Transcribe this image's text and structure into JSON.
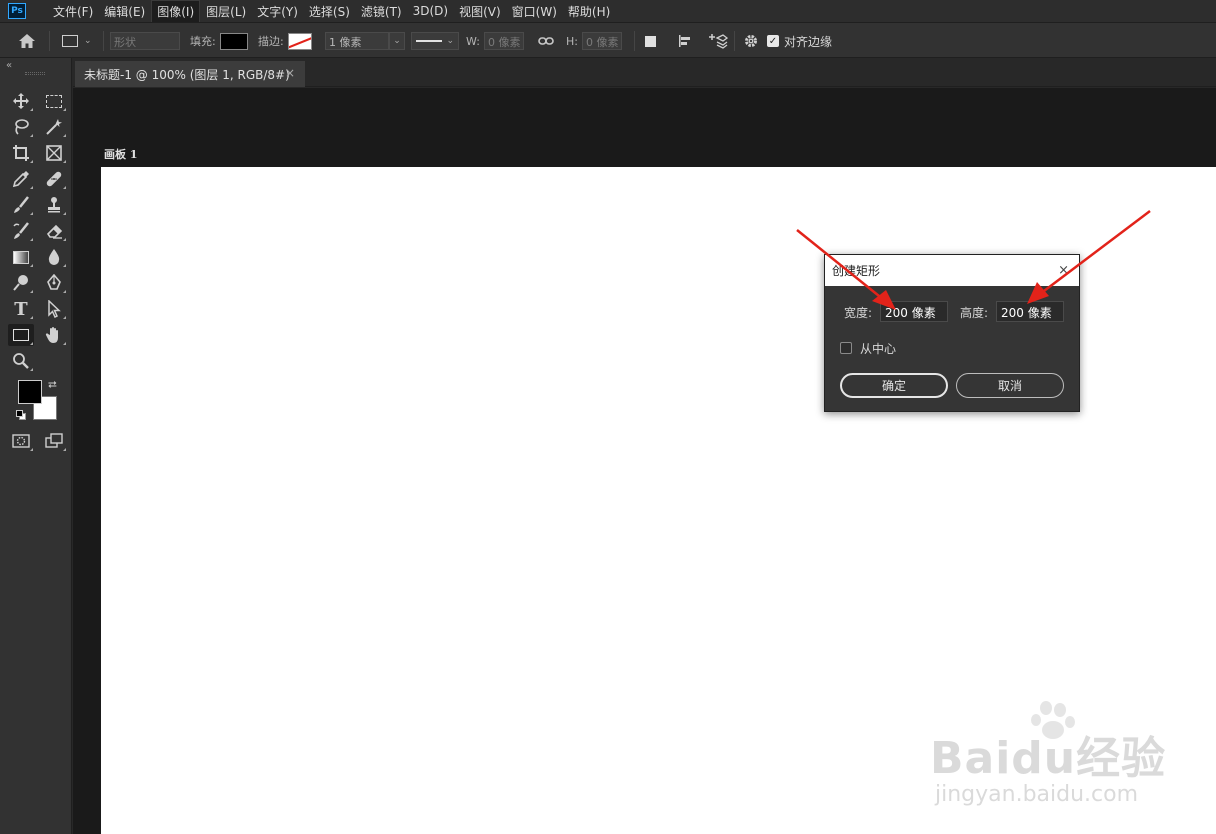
{
  "app": {
    "logo_text": "Ps",
    "menu": [
      "文件(F)",
      "编辑(E)",
      "图像(I)",
      "图层(L)",
      "文字(Y)",
      "选择(S)",
      "滤镜(T)",
      "3D(D)",
      "视图(V)",
      "窗口(W)",
      "帮助(H)"
    ],
    "active_menu_index": 2
  },
  "options_bar": {
    "mode_value": "形状",
    "fill_label": "填充:",
    "stroke_label": "描边:",
    "stroke_width_value": "1 像素",
    "w_label": "W:",
    "w_value": "0 像素",
    "h_label": "H:",
    "h_value": "0 像素",
    "align_edges_label": "对齐边缘",
    "align_edges_checked": true
  },
  "document": {
    "tab_title": "未标题-1 @ 100% (图层 1, RGB/8#)",
    "tab_close": "×",
    "artboard_label": "画板 1"
  },
  "dialog": {
    "title": "创建矩形",
    "close": "×",
    "width_label": "宽度:",
    "width_value": "200 像素",
    "height_label": "高度:",
    "height_value": "200 像素",
    "from_center_label": "从中心",
    "from_center_checked": false,
    "ok_label": "确定",
    "cancel_label": "取消"
  },
  "colors": {
    "accent_ps": "#31a8ff",
    "arrow_red": "#e2231a",
    "canvas": "#ffffff",
    "foreground": "#000000",
    "background": "#ffffff"
  },
  "watermark": {
    "brand": "Baidu经验",
    "url": "jingyan.baidu.com"
  }
}
